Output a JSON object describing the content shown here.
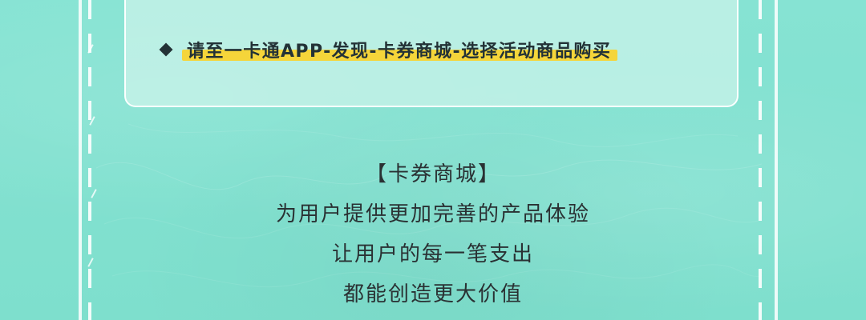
{
  "notice": {
    "text": "请至一卡通APP-发现-卡券商城-选择活动商品购买",
    "bullet_icon": "diamond-bullet-icon",
    "highlight_color": "#f5d53a"
  },
  "description": {
    "lines": [
      "【卡券商城】",
      "为用户提供更加完善的产品体验",
      "让用户的每一笔支出",
      "都能创造更大价值"
    ]
  },
  "colors": {
    "background": "#80e0cf",
    "card_background": "#d2f5ec",
    "text": "#2a3133",
    "frame": "#ffffff"
  }
}
